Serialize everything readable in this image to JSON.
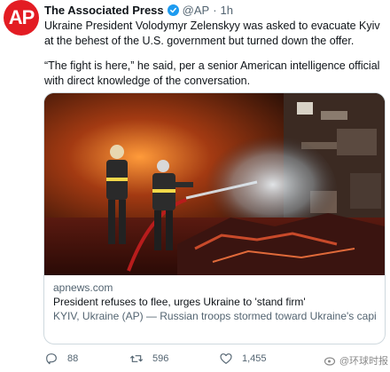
{
  "tweet": {
    "avatar_text": "AP",
    "author_name": "The Associated Press",
    "handle": "@AP",
    "dot": "·",
    "time": "1h",
    "more_icon": "···",
    "paragraphs": [
      "Ukraine President Volodymyr Zelenskyy was asked to evacuate Kyiv at the behest of the U.S. government but turned down the offer.",
      "“The fight is here,” he said, per a senior American intelligence official with direct knowledge of the conversation."
    ]
  },
  "card": {
    "image_icon": "firefighters-photo",
    "domain": "apnews.com",
    "title": "President refuses to flee, urges Ukraine to 'stand firm'",
    "description": "KYIV, Ukraine (AP) — Russian troops stormed toward Ukraine's capital early Saturday as explosions reverberated through the city and the ..."
  },
  "actions": {
    "reply_count": "88",
    "retweet_count": "596",
    "like_count": "1,455"
  },
  "watermark": {
    "text": "@环球时报"
  },
  "colors": {
    "avatar": "#e31c23",
    "verified": "#1d9bf0",
    "muted": "#536471",
    "border": "#cfd9de"
  }
}
